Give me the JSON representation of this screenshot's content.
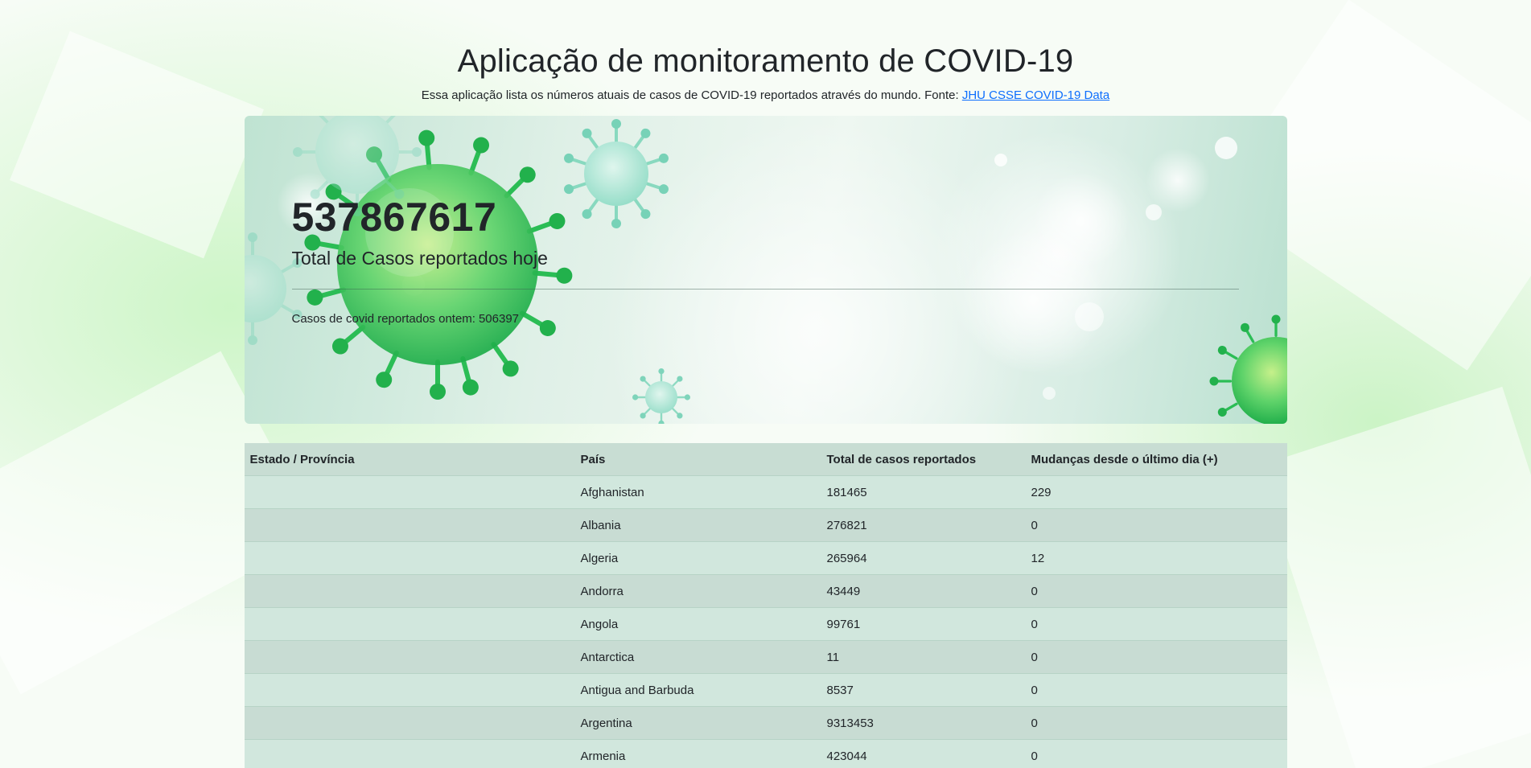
{
  "header": {
    "title": "Aplicação de monitoramento de COVID-19",
    "subtitle": "Essa aplicação lista os números atuais de casos de COVID-19 reportados através do mundo. Fonte:",
    "source_link": "JHU CSSE COVID-19 Data"
  },
  "summary": {
    "total_cases": "537867617",
    "total_label": "Total de Casos reportados hoje",
    "yesterday_label": "Casos de covid reportados ontem:",
    "yesterday_value": "506397"
  },
  "table": {
    "headers": {
      "state": "Estado / Província",
      "country": "País",
      "total": "Total de casos reportados",
      "change": "Mudanças desde o último dia (+)"
    },
    "rows": [
      {
        "state": "",
        "country": "Afghanistan",
        "total": "181465",
        "change": "229"
      },
      {
        "state": "",
        "country": "Albania",
        "total": "276821",
        "change": "0"
      },
      {
        "state": "",
        "country": "Algeria",
        "total": "265964",
        "change": "12"
      },
      {
        "state": "",
        "country": "Andorra",
        "total": "43449",
        "change": "0"
      },
      {
        "state": "",
        "country": "Angola",
        "total": "99761",
        "change": "0"
      },
      {
        "state": "",
        "country": "Antarctica",
        "total": "11",
        "change": "0"
      },
      {
        "state": "",
        "country": "Antigua and Barbuda",
        "total": "8537",
        "change": "0"
      },
      {
        "state": "",
        "country": "Argentina",
        "total": "9313453",
        "change": "0"
      },
      {
        "state": "",
        "country": "Armenia",
        "total": "423044",
        "change": "0"
      }
    ]
  },
  "colors": {
    "link": "#0d6efd",
    "table_row_odd": "#d1e7dd",
    "table_row_even": "#c8dcd3",
    "virus_green": "#22b14c"
  }
}
